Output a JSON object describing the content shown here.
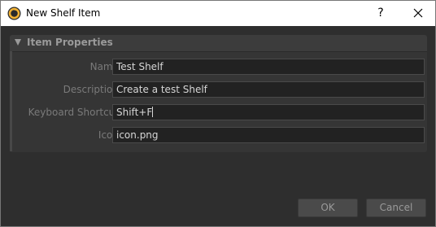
{
  "window": {
    "title": "New Shelf Item",
    "help_label": "?",
    "icons": {
      "app": "nuke-app-icon",
      "close": "close-icon"
    }
  },
  "group": {
    "title": "Item Properties",
    "expanded": true
  },
  "fields": {
    "name": {
      "label": "Name",
      "value": "Test Shelf"
    },
    "description": {
      "label": "Description",
      "value": "Create a test Shelf"
    },
    "shortcut": {
      "label": "Keyboard Shortcut",
      "value": "Shift+F"
    },
    "icon": {
      "label": "Icon",
      "value": "icon.png"
    }
  },
  "buttons": {
    "ok": "OK",
    "cancel": "Cancel"
  },
  "colors": {
    "background": "#2e2e2e",
    "field_bg": "#222222",
    "label": "#7a7a7a",
    "text": "#d6d6d6",
    "button": "#4a4a4a"
  }
}
